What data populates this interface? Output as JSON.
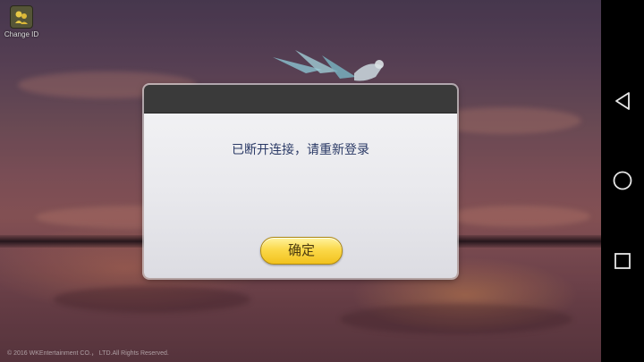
{
  "top_left": {
    "change_id_label": "Change ID",
    "change_id_icon": "change-id-icon"
  },
  "dialog": {
    "message": "已断开连接，请重新登录",
    "confirm_label": "确定",
    "confirm_color": "#f7cf33"
  },
  "footer": {
    "copyright": "© 2016 WKEntertainment CO.， LTD.All Rights Reserved."
  },
  "nav": {
    "back_icon": "triangle-back-icon",
    "home_icon": "circle-home-icon",
    "recents_icon": "square-recents-icon"
  }
}
